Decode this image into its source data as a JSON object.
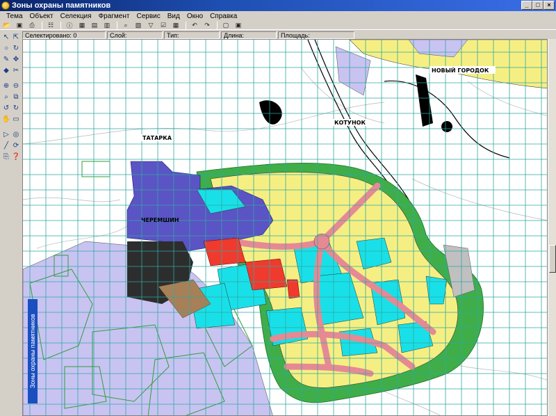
{
  "window": {
    "title": "Зоны охраны памятников",
    "minimize": "_",
    "maximize": "□",
    "close": "×"
  },
  "menu": [
    "Тема",
    "Объект",
    "Селекция",
    "Фрагмент",
    "Сервис",
    "Вид",
    "Окно",
    "Справка"
  ],
  "toolbar": {
    "buttons": [
      "open-icon",
      "save-icon",
      "print-icon",
      "layers-icon",
      "info-icon",
      "table-icon",
      "grid-icon",
      "table2-icon",
      "zoom-icon",
      "legend-icon",
      "filter-icon",
      "select-icon",
      "grid2-icon",
      "undo-icon",
      "redo-icon",
      "window-icon",
      "view-icon"
    ]
  },
  "status": {
    "selected": "Селектировано: 0",
    "layer": "Слой:",
    "type": "Тип:",
    "length": "Длина:",
    "area": "Площадь:"
  },
  "tools": [
    [
      "arrow-icon",
      "select-icon"
    ],
    [
      "node-icon",
      "rotate-icon"
    ],
    [
      "edit-icon",
      "move-icon"
    ],
    [
      "vertex-icon",
      "split-icon"
    ],
    [
      "zoom-in-icon",
      "zoom-out-icon"
    ],
    [
      "zoom-window-icon",
      "zoom-extent-icon"
    ],
    [
      "rotate-left-icon",
      "rotate-right-icon"
    ],
    [
      "pan-icon",
      "measure-icon"
    ],
    [
      "pointer-icon",
      "target-icon"
    ],
    [
      "draw-icon",
      "refresh-icon"
    ],
    [
      "copy-icon",
      "help-icon"
    ]
  ],
  "map": {
    "labels": {
      "novy_gorodok": "НОВЫЙ ГОРОДОК",
      "tatarka": "ТАТАРКА",
      "cheremshin": "ЧЕРЕМШИН",
      "kotunok": "КОТУНОК"
    },
    "side_label": "Зоны охраны памятников"
  },
  "colors": {
    "title_from": "#0a246a",
    "title_to": "#3a6ee8",
    "green_zone": "#3fae49",
    "cyan_zone": "#19e0e8",
    "yellow_zone": "#f5ef83",
    "pink_road": "#e58a94",
    "red_zone": "#f03a2e",
    "blue_zone": "#5b54c4",
    "lavender_zone": "#c9c3f2",
    "grid": "#2ea8a0"
  }
}
